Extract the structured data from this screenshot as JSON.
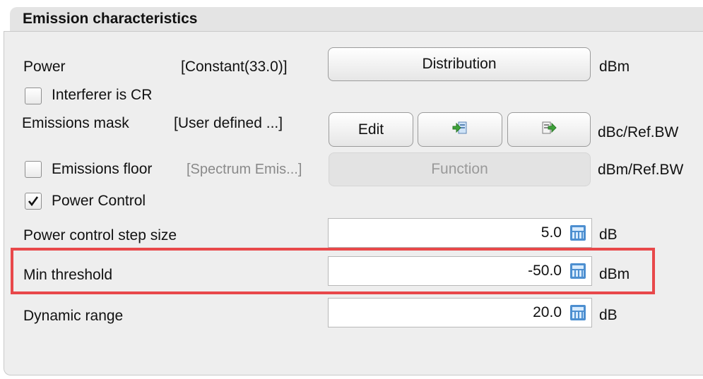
{
  "section": {
    "title": "Emission characteristics"
  },
  "power": {
    "label": "Power",
    "value": "[Constant(33.0)]",
    "button": "Distribution",
    "unit": "dBm"
  },
  "interferer_cr": {
    "label": "Interferer is CR",
    "checked": false
  },
  "emissions_mask": {
    "label": "Emissions mask",
    "value": "[User defined ...]",
    "edit_button": "Edit",
    "import_icon": "import-icon",
    "export_icon": "export-icon",
    "unit": "dBc/Ref.BW"
  },
  "emissions_floor": {
    "label": "Emissions floor",
    "value": "[Spectrum Emis...]",
    "button": "Function",
    "unit": "dBm/Ref.BW",
    "checked": false
  },
  "power_control": {
    "label": "Power Control",
    "checked": true
  },
  "step_size": {
    "label": "Power control step size",
    "value": "5.0",
    "unit": "dB"
  },
  "min_threshold": {
    "label": "Min threshold",
    "value": "-50.0",
    "unit": "dBm"
  },
  "dynamic_range": {
    "label": "Dynamic range",
    "value": "20.0",
    "unit": "dB"
  },
  "colors": {
    "highlight": "#e8484a",
    "calc_icon": "#4d8fd0"
  }
}
